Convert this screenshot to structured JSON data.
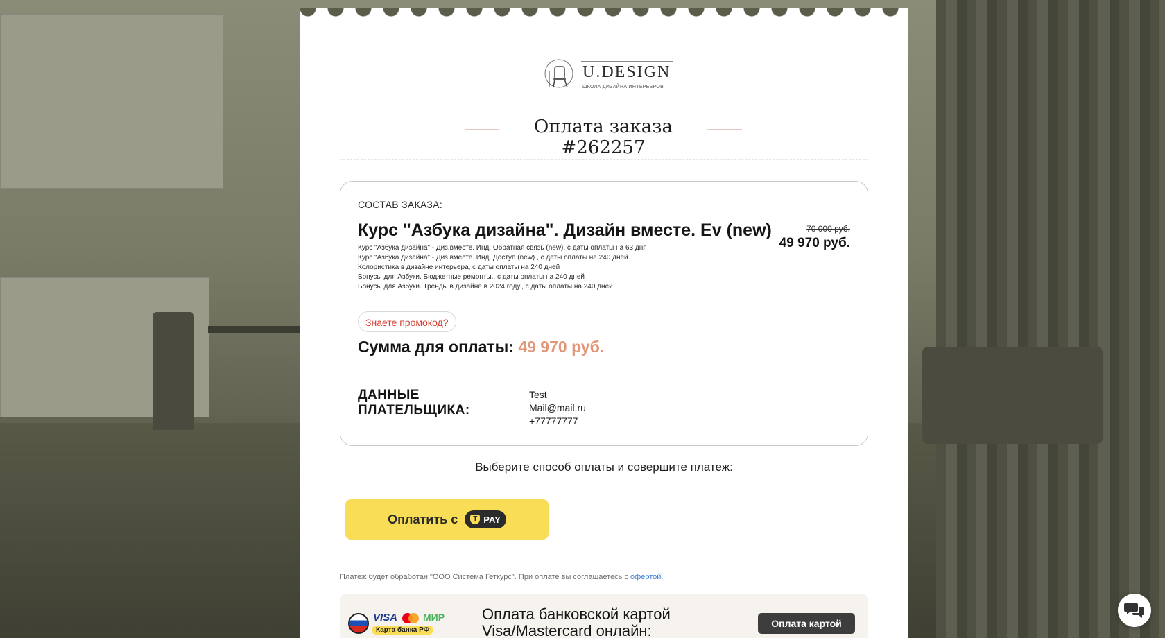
{
  "brand": {
    "name": "U.DESIGN",
    "tagline": "ШКОЛА ДИЗАЙНА ИНТЕРЬЕРОВ"
  },
  "page_title": "Оплата заказа #262257",
  "order": {
    "label": "СОСТАВ ЗАКАЗА:",
    "product_title": "Курс \"Азбука дизайна\". Дизайн вместе. Ev (new)",
    "old_price": "70 000 руб.",
    "new_price": "49 970 руб.",
    "items": [
      "Курс \"Азбука дизайна\" - Диз.вместе. Инд. Обратная связь (new), с даты оплаты на 63 дня",
      "Курс \"Азбука дизайна\" - Диз.вместе. Инд. Доступ (new) , с даты оплаты на 240 дней",
      "Колористика в дизайне интерьера, с даты оплаты на 240 дней",
      "Бонусы для Азбуки. Бюджетные ремонты., с даты оплаты на 240 дней",
      "Бонусы для Азбуки. Тренды в дизайне в 2024 году., с даты оплаты на 240 дней"
    ],
    "promo_label": "Знаете промокод?",
    "total_label": "Сумма для оплаты:",
    "total_amount": "49 970 руб."
  },
  "payer": {
    "heading_line1": "ДАННЫЕ",
    "heading_line2": "ПЛАТЕЛЬЩИКА:",
    "name": "Test",
    "email": "Mail@mail.ru",
    "phone": "+77777777"
  },
  "payment": {
    "choose_text": "Выберите способ оплаты и совершите платеж:",
    "tpay_label": "Оплатить с",
    "tpay_badge": "PAY",
    "note_text": "Платеж будет обработан \"ООО Система Геткурс\". При оплате вы соглашаетесь с ",
    "note_link": "офертой.",
    "bank": {
      "visa": "VISA",
      "mir": "МИР",
      "rf_card": "Карта банка РФ",
      "title_line1": "Оплата банковской картой",
      "title_line2": "Visa/Mastercard онлайн:",
      "button_label": "Оплата картой"
    }
  },
  "colors": {
    "accent_total": "#e2977a",
    "tpay_yellow": "#fadd57",
    "promo_red": "#d44235",
    "link_blue": "#3b7bd6"
  },
  "icons": [
    "chat-icon",
    "tpay-shield-icon",
    "logo-mark-icon"
  ]
}
